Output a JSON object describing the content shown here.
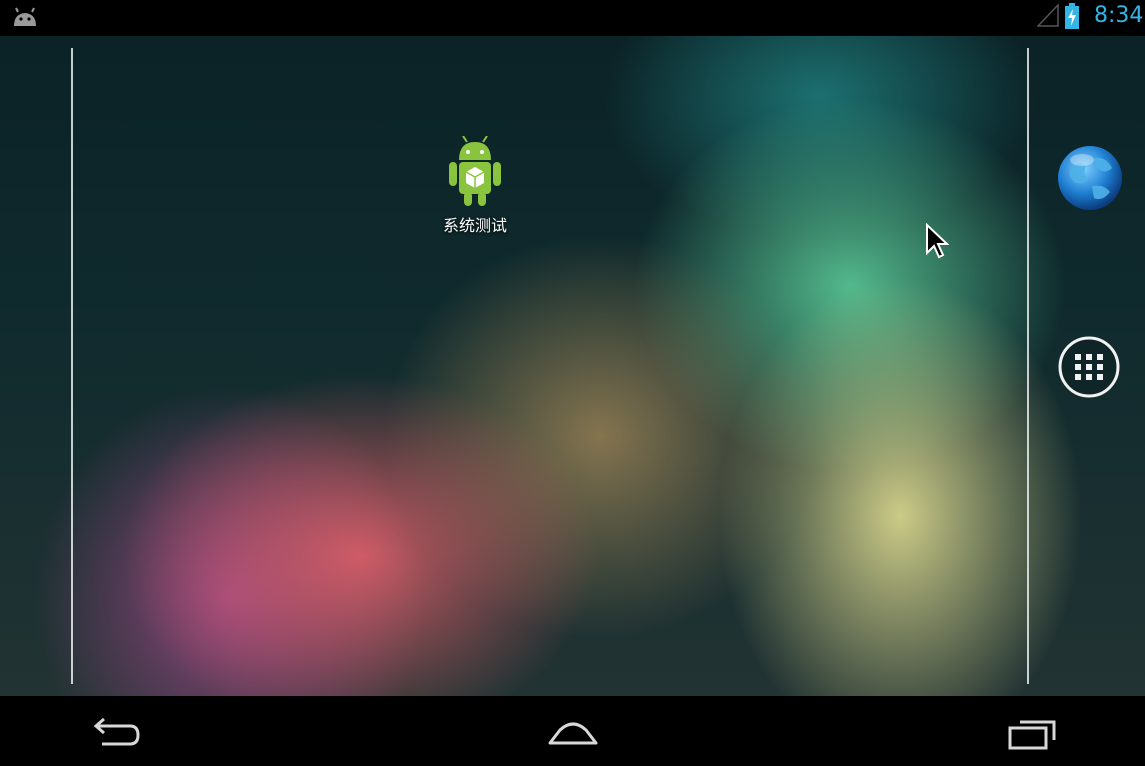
{
  "status_bar": {
    "clock": "8:34",
    "notification_icon": "android-debug-icon",
    "signal_icon": "signal-empty-icon",
    "battery_icon": "battery-charging-icon",
    "accent_color": "#33b5e5"
  },
  "home_screen": {
    "shortcuts": [
      {
        "label": "系统测试",
        "icon": "android-app-icon"
      }
    ],
    "hotseat": [
      {
        "icon": "browser-globe-icon"
      },
      {
        "icon": "all-apps-icon"
      }
    ]
  },
  "nav_bar": {
    "buttons": [
      {
        "icon": "back-icon"
      },
      {
        "icon": "home-icon"
      },
      {
        "icon": "recents-icon"
      }
    ]
  }
}
